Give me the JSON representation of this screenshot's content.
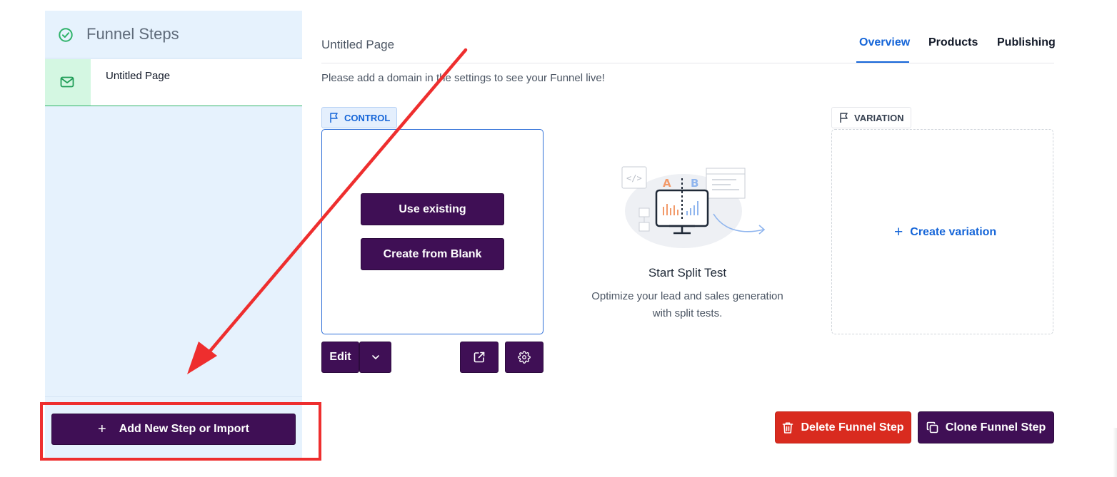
{
  "sidebar": {
    "title": "Funnel Steps",
    "steps": [
      {
        "label": "Untitled Page",
        "icon": "envelope-icon"
      }
    ],
    "add_button": "Add New Step or Import"
  },
  "header": {
    "page_title": "Untitled Page",
    "tabs": [
      {
        "label": "Overview",
        "active": true
      },
      {
        "label": "Products",
        "active": false
      },
      {
        "label": "Publishing",
        "active": false
      }
    ],
    "notice": "Please add a domain in the settings to see your Funnel live!"
  },
  "control": {
    "badge": "CONTROL",
    "use_existing": "Use existing",
    "create_blank": "Create from Blank",
    "edit": "Edit"
  },
  "split_test": {
    "label_a": "A",
    "label_b": "B",
    "title": "Start Split Test",
    "description_line1": "Optimize your lead and sales generation",
    "description_line2": "with split tests."
  },
  "variation": {
    "badge": "VARIATION",
    "create": "Create variation"
  },
  "footer": {
    "delete": "Delete Funnel Step",
    "clone": "Clone Funnel Step"
  },
  "colors": {
    "primary_dark": "#3f0f55",
    "accent_blue": "#1565d8",
    "danger": "#d92b1f",
    "sidebar_bg": "#e6f2fd",
    "success_green": "#2fb36a",
    "annotation_red": "#ee2e2e"
  }
}
